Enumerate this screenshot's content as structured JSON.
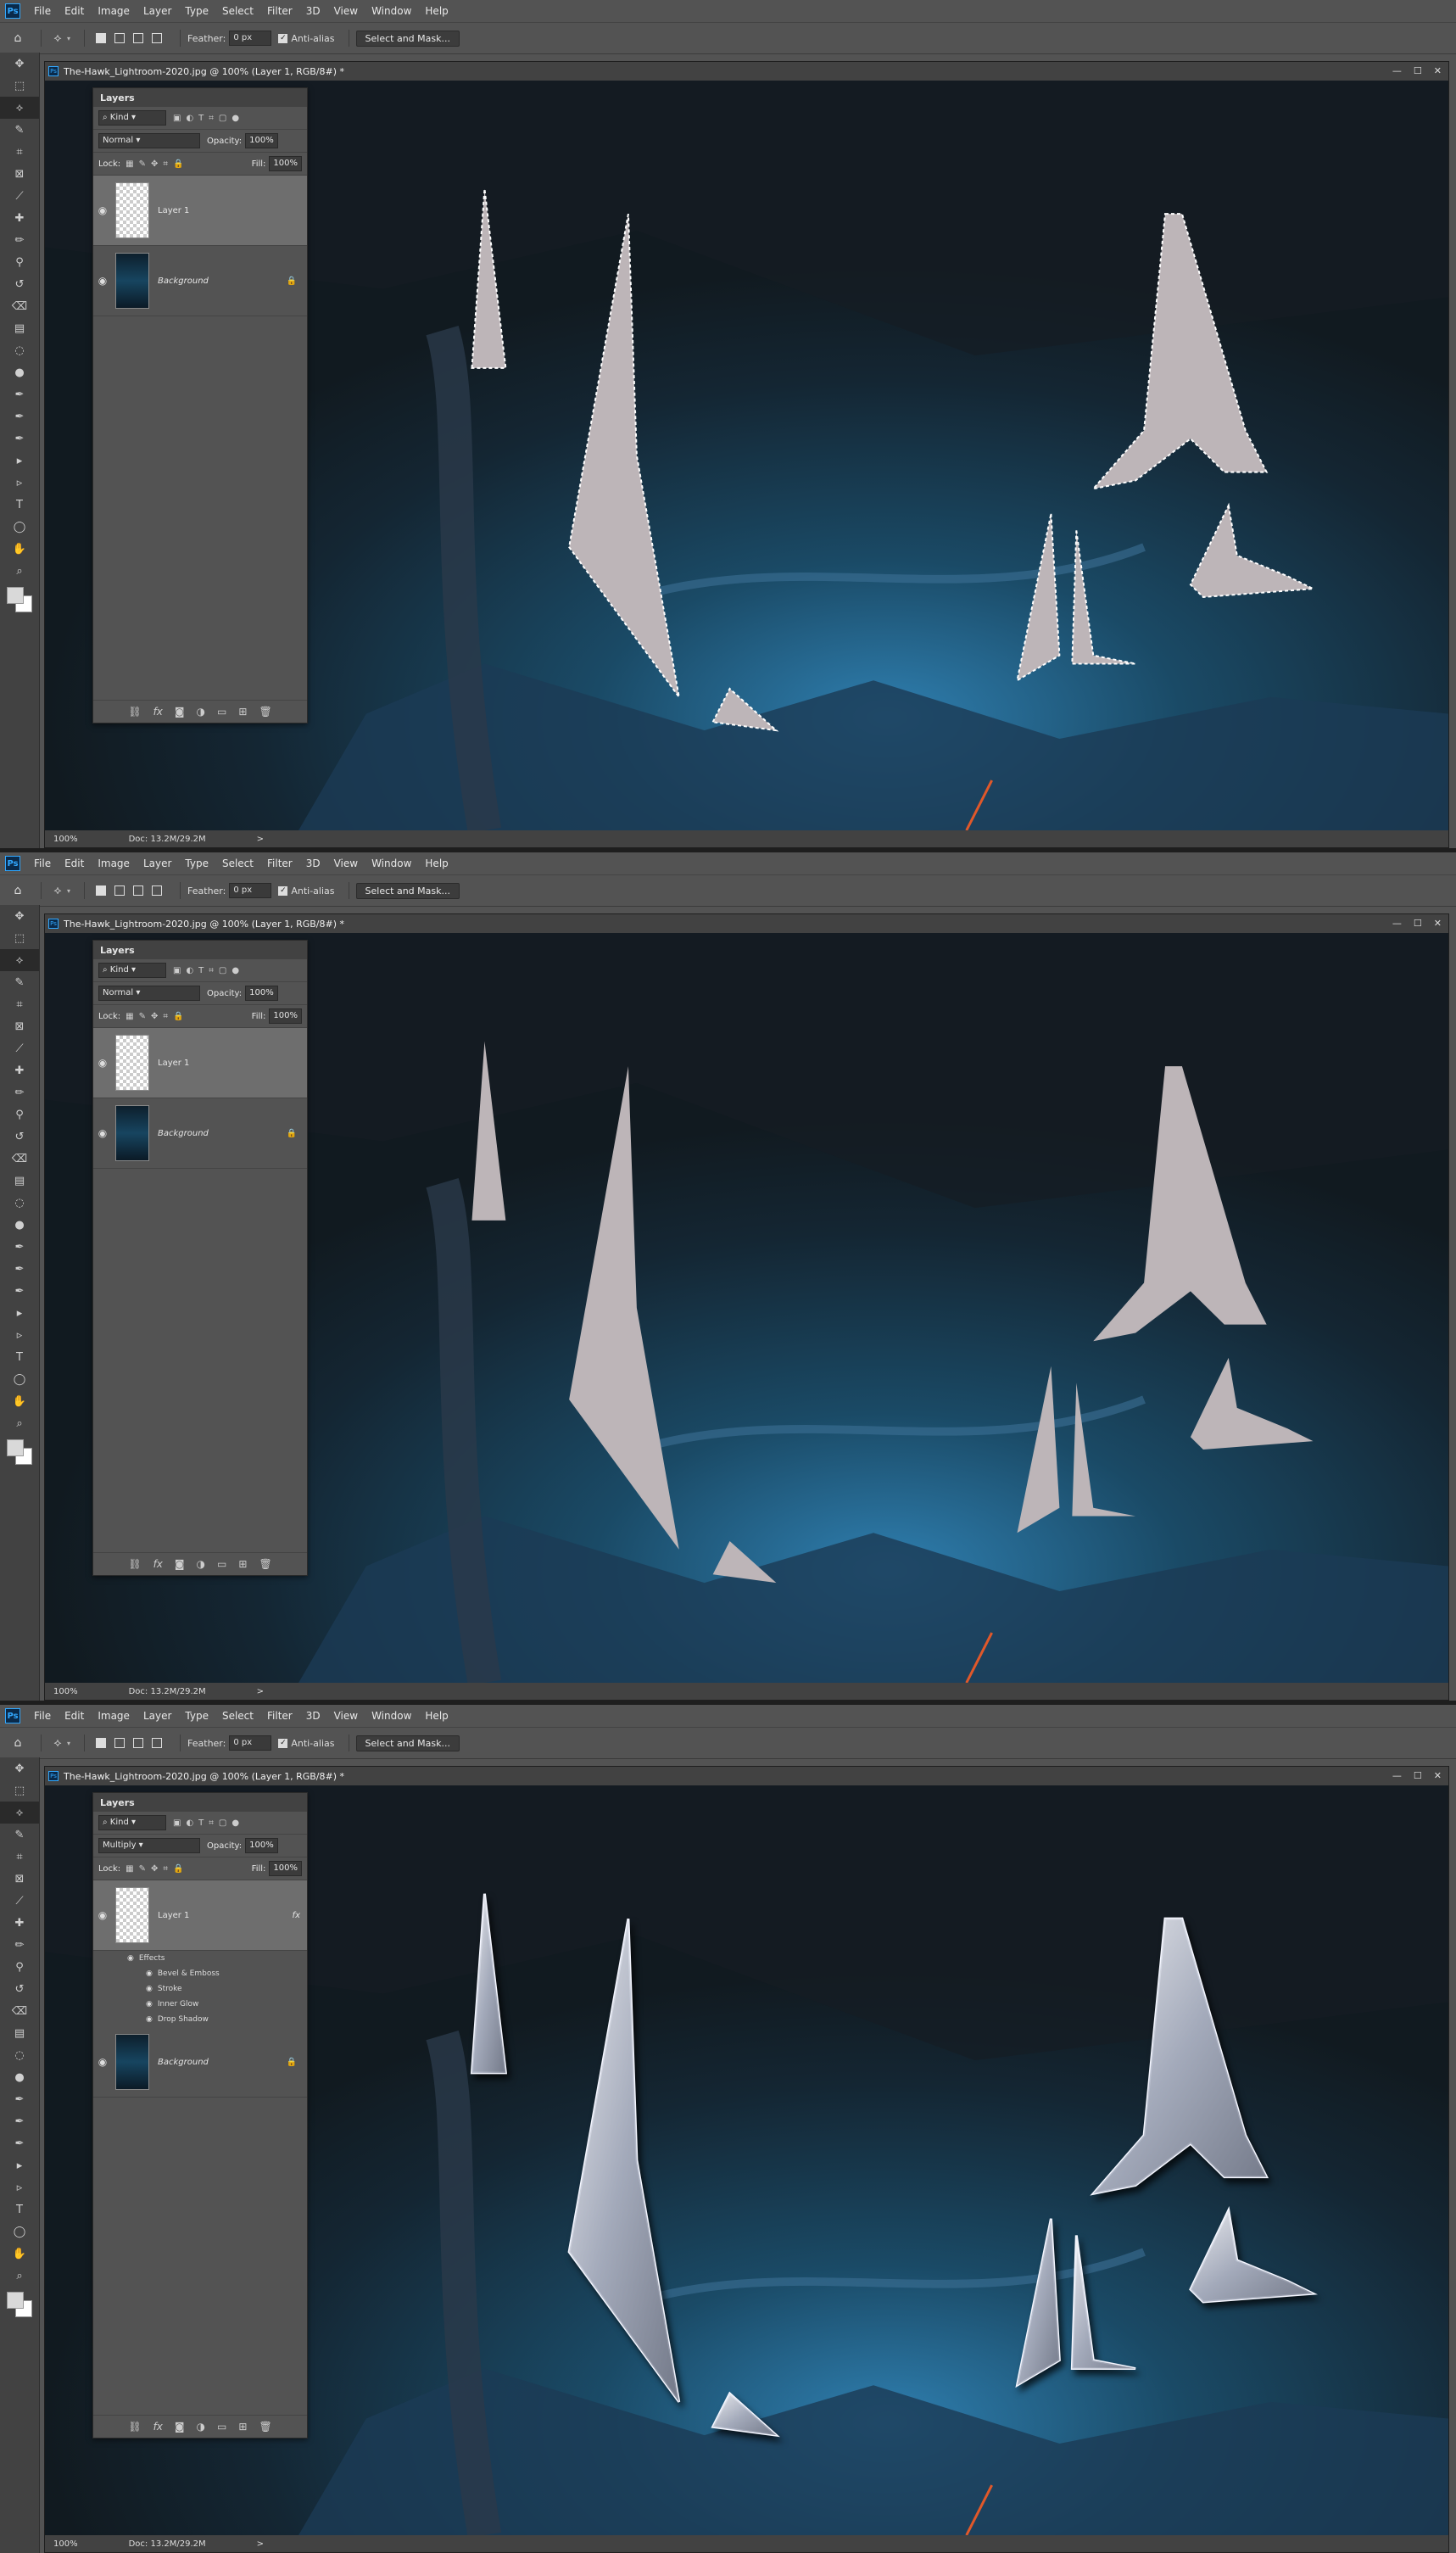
{
  "app": {
    "logo": "Ps",
    "menus": [
      "File",
      "Edit",
      "Image",
      "Layer",
      "Type",
      "Select",
      "Filter",
      "3D",
      "View",
      "Window",
      "Help"
    ]
  },
  "options": {
    "feather_label": "Feather:",
    "feather_value": "0 px",
    "antialias_label": "Anti-alias",
    "select_mask_label": "Select and Mask..."
  },
  "document": {
    "title": "The-Hawk_Lightroom-2020.jpg @ 100% (Layer 1, RGB/8#) *",
    "zoom": "100%",
    "doc_size": "Doc: 13.2M/29.2M",
    "status_arrow": ">"
  },
  "layers_panel": {
    "title": "Layers",
    "kind_label": "Kind",
    "opacity_label": "Opacity:",
    "opacity_value": "100%",
    "lock_label": "Lock:",
    "fill_label": "Fill:",
    "fill_value": "100%",
    "layer1_name": "Layer 1",
    "background_name": "Background",
    "fx_label": "fx"
  },
  "frames": [
    {
      "blend_mode": "Normal",
      "state": "selection"
    },
    {
      "blend_mode": "Normal",
      "state": "filled"
    },
    {
      "blend_mode": "Multiply",
      "state": "styled",
      "effects_header": "Effects",
      "effects": [
        "Bevel & Emboss",
        "Stroke",
        "Inner Glow",
        "Drop Shadow"
      ]
    }
  ],
  "colors": {
    "fill_shape": "#bdb5b8",
    "accent": "#31a8ff"
  }
}
